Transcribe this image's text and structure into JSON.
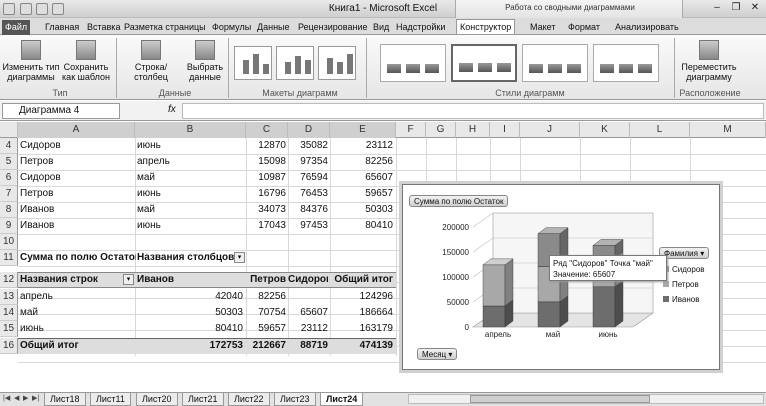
{
  "window": {
    "title": "Книга1 - Microsoft Excel",
    "context_group": "Работа со сводными диаграммами"
  },
  "tabs": [
    "Файл",
    "Главная",
    "Вставка",
    "Разметка страницы",
    "Формулы",
    "Данные",
    "Рецензирование",
    "Вид",
    "Надстройки",
    "Конструктор",
    "Макет",
    "Формат",
    "Анализировать"
  ],
  "ribbon": {
    "change_type": "Изменить тип диаграммы",
    "save_template": "Сохранить как шаблон",
    "row_col": "Строка/столбец",
    "select_data": "Выбрать данные",
    "move_chart": "Переместить диаграмму",
    "groups": {
      "type": "Тип",
      "data": "Данные",
      "layouts": "Макеты диаграмм",
      "styles": "Стили диаграмм",
      "location": "Расположение"
    }
  },
  "formula_bar": {
    "name_box": "Диаграмма 4",
    "fx": "fx",
    "content": ""
  },
  "columns": [
    "A",
    "B",
    "C",
    "D",
    "E",
    "F",
    "G",
    "H",
    "I",
    "J",
    "K",
    "L",
    "M"
  ],
  "data_rows": [
    {
      "n": "4",
      "a": "Сидоров",
      "b": "июнь",
      "c": "12870",
      "d": "35082",
      "e": "23112"
    },
    {
      "n": "5",
      "a": "Петров",
      "b": "апрель",
      "c": "15098",
      "d": "97354",
      "e": "82256"
    },
    {
      "n": "6",
      "a": "Сидоров",
      "b": "май",
      "c": "10987",
      "d": "76594",
      "e": "65607"
    },
    {
      "n": "7",
      "a": "Петров",
      "b": "июнь",
      "c": "16796",
      "d": "76453",
      "e": "59657"
    },
    {
      "n": "8",
      "a": "Иванов",
      "b": "май",
      "c": "34073",
      "d": "84376",
      "e": "50303"
    },
    {
      "n": "9",
      "a": "Иванов",
      "b": "июнь",
      "c": "17043",
      "d": "97453",
      "e": "80410"
    },
    {
      "n": "10",
      "a": "",
      "b": "",
      "c": "",
      "d": "",
      "e": ""
    }
  ],
  "pivot": {
    "r11": {
      "n": "11",
      "a": "Сумма по полю Остаток",
      "b": "Названия столбцов"
    },
    "r12": {
      "n": "12",
      "a": "Названия строк",
      "b": "Иванов",
      "c": "Петров",
      "d": "Сидоров",
      "e": "Общий итог"
    },
    "rows": [
      {
        "n": "13",
        "a": "апрель",
        "b": "42040",
        "c": "82256",
        "d": "",
        "e": "124296"
      },
      {
        "n": "14",
        "a": "май",
        "b": "50303",
        "c": "70754",
        "d": "65607",
        "e": "186664"
      },
      {
        "n": "15",
        "a": "июнь",
        "b": "80410",
        "c": "59657",
        "d": "23112",
        "e": "163179"
      }
    ],
    "total": {
      "n": "16",
      "a": "Общий итог",
      "b": "172753",
      "c": "212667",
      "d": "88719",
      "e": "474139"
    }
  },
  "chart": {
    "field_button": "Сумма по полю Остаток",
    "legend_button": "Фамилия",
    "axis_button": "Месяц",
    "tooltip_line1": "Ряд \"Сидоров\" Точка \"май\"",
    "tooltip_line2": "Значение: 65607"
  },
  "chart_data": {
    "type": "bar",
    "categories": [
      "апрель",
      "май",
      "июнь"
    ],
    "series": [
      {
        "name": "Иванов",
        "values": [
          42040,
          50303,
          80410
        ]
      },
      {
        "name": "Петров",
        "values": [
          82256,
          70754,
          59657
        ]
      },
      {
        "name": "Сидоров",
        "values": [
          0,
          65607,
          23112
        ]
      }
    ],
    "y_ticks": [
      "0",
      "50000",
      "100000",
      "150000",
      "200000"
    ],
    "ylim": [
      0,
      200000
    ],
    "stacked": true,
    "legend": "right",
    "grid": true
  },
  "sheets": [
    "Лист18",
    "Лист11",
    "Лист20",
    "Лист21",
    "Лист22",
    "Лист23",
    "Лист24"
  ],
  "active_sheet": "Лист24"
}
